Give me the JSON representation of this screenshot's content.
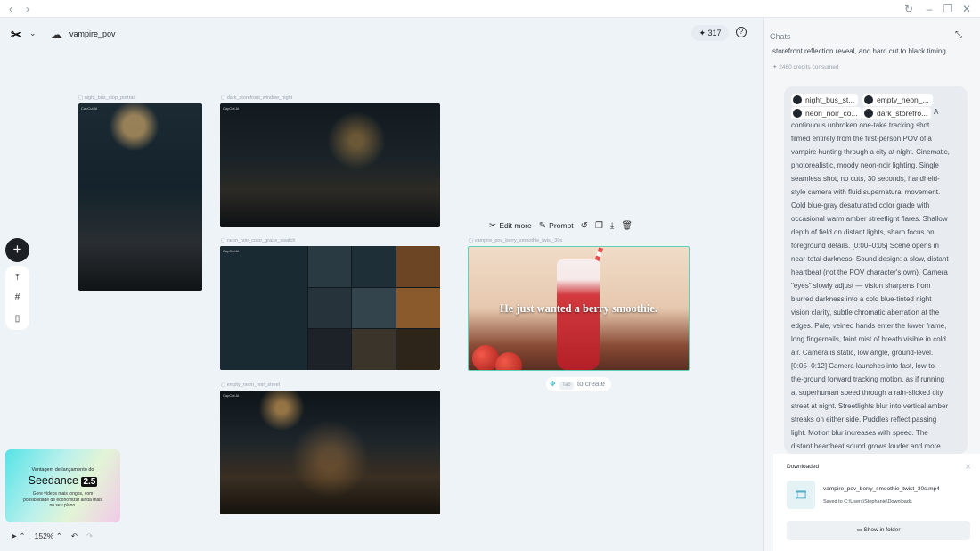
{
  "titlebar": {
    "back_icon": "chevron-left-icon",
    "forward_icon": "chevron-right-icon",
    "refresh_icon": "refresh-icon",
    "minimize_icon": "minimize-icon",
    "restore_icon": "restore-icon",
    "close_icon": "close-icon"
  },
  "header": {
    "project_name": "vampire_pov",
    "credits": "317"
  },
  "artboards": {
    "bus_label": "night_bus_stop_portrait",
    "store_label": "dark_storefront_window_night",
    "swatch_label": "neon_noir_color_grade_swatch",
    "smoothie_label": "vampire_pov_berry_smoothie_twist_30s",
    "street_label": "empty_neon_noir_street",
    "watermark": "CapCut AI",
    "smoothie_caption": "He just wanted a berry smoothie."
  },
  "float_toolbar": {
    "edit_more": "Edit more",
    "prompt": "Prompt"
  },
  "tab_hint": {
    "key": "Tab",
    "text": "to create"
  },
  "promo": {
    "line1": "Vantagem de lançamento do",
    "brand": "Seedance",
    "version": "2.5",
    "desc": "Gere vídeos mais longos, com possibilidade de economizar ainda mais no seu plano."
  },
  "bottom": {
    "zoom": "152%"
  },
  "chat": {
    "title": "Chats",
    "prev_message": "storefront reflection reveal, and hard cut to black timing.",
    "credits_used": "2460 credits consumed",
    "refs": [
      "night_bus_st...",
      "empty_neon_...",
      "neon_noir_co...",
      "dark_storefro..."
    ],
    "message_lead": "A",
    "message_lines": [
      "continuous unbroken one-take tracking shot",
      "filmed entirely from the first-person POV of a",
      "vampire hunting through a city at night. Cinematic,",
      "photorealistic, moody neon-noir lighting. Single",
      "seamless shot, no cuts, 30 seconds, handheld-",
      "style camera with fluid supernatural movement.",
      "Cold blue-gray desaturated color grade with",
      "occasional warm amber streetlight flares. Shallow",
      "depth of field on distant lights, sharp focus on",
      "foreground details. [0:00–0:05] Scene opens in",
      "near-total darkness. Sound design: a slow, distant",
      "heartbeat (not the POV character's own). Camera",
      "\"eyes\" slowly adjust — vision sharpens from",
      "blurred darkness into a cold blue-tinted night",
      "vision clarity, subtle chromatic aberration at the",
      "edges. Pale, veined hands enter the lower frame,",
      "long fingernails, faint mist of breath visible in cold",
      "air. Camera is static, low angle, ground-level.",
      "[0:05–0:12] Camera launches into fast, low-to-",
      "the-ground forward tracking motion, as if running",
      "at superhuman speed through a rain-slicked city",
      "street at night. Streetlights blur into vertical amber",
      "streaks on either side. Puddles reflect passing",
      "light. Motion blur increases with speed. The",
      "distant heartbeat sound grows louder and more"
    ]
  },
  "download": {
    "title": "Downloaded",
    "filename": "vampire_pov_berry_smoothie_twist_30s.mp4",
    "path": "Saved to C:\\Users\\Stephanie\\Downloads",
    "button": "Show in folder"
  }
}
